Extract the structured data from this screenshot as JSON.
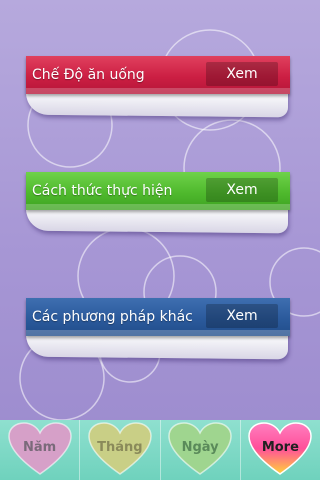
{
  "cards": [
    {
      "label": "Chế Độ ăn uống",
      "button": "Xem",
      "color": "#cc1f43"
    },
    {
      "label": "Cách thức thực hiện",
      "button": "Xem",
      "color": "#4fb92d"
    },
    {
      "label": "Các phương pháp khác",
      "button": "Xem",
      "color": "#2b5a9c"
    }
  ],
  "tabs": [
    {
      "label": "Năm",
      "icon": "heart-icon",
      "color": "#d6a0c8",
      "text_color": "#7a6a7a"
    },
    {
      "label": "Tháng",
      "icon": "heart-icon",
      "color": "#c9cf86",
      "text_color": "#8a8a5a"
    },
    {
      "label": "Ngày",
      "icon": "heart-icon",
      "color": "#9fd58f",
      "text_color": "#5a8a5a"
    },
    {
      "label": "More",
      "icon": "heart-icon",
      "color": "#ff5fa0",
      "text_color": "#222222",
      "active": true
    }
  ]
}
